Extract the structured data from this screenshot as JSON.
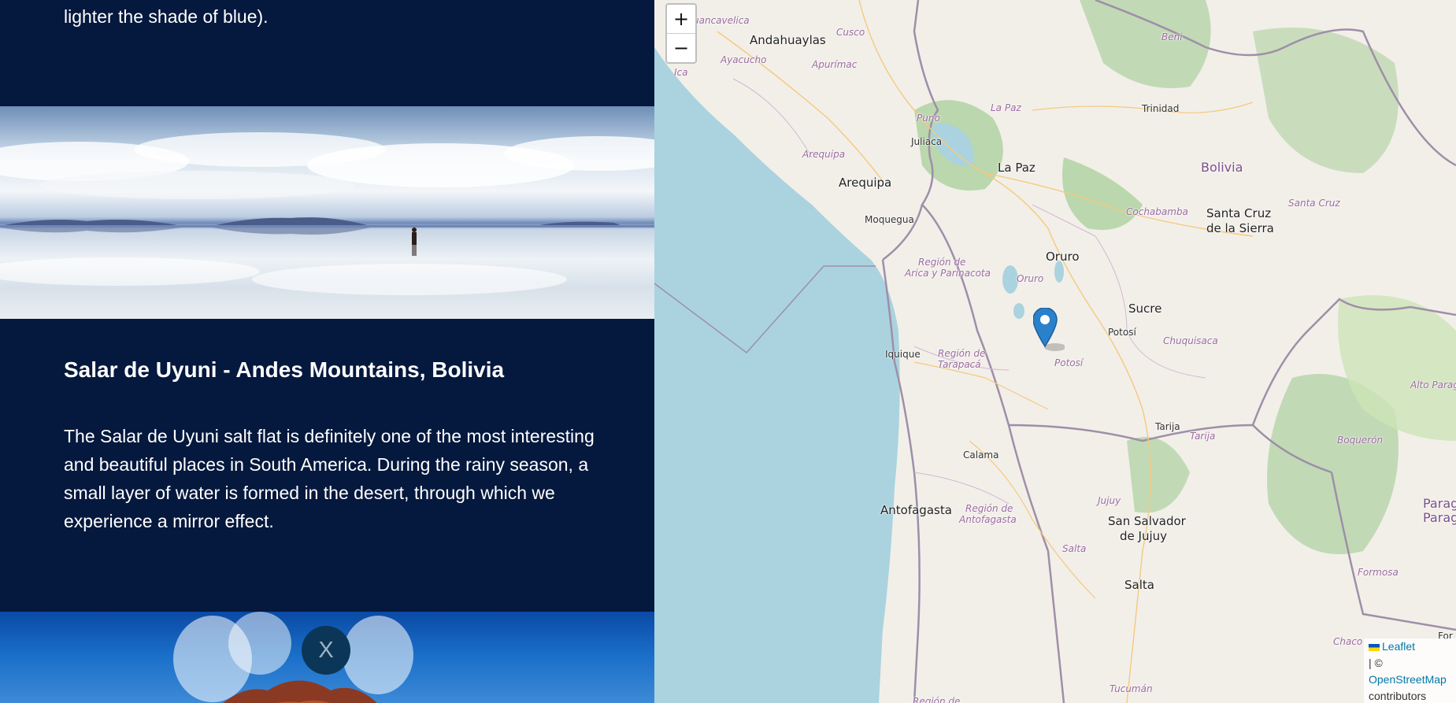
{
  "story": {
    "prev_text": "lighter the shade of blue).",
    "title": "Salar de Uyuni - Andes Mountains, Bolivia",
    "body": "The Salar de Uyuni salt flat is definitely one of the most interesting and beautiful places in South America. During the rainy season, a small layer of water is formed in the desert, through which we experience a mirror effect.",
    "close_label": "X"
  },
  "map": {
    "zoom_in": "+",
    "zoom_out": "−",
    "marker_icon": "map-pin-icon",
    "labels": {
      "andahuaylas": "Andahuaylas",
      "cusco": "Cusco",
      "huancavelica": "Huancavelica",
      "ayacucho": "Ayacucho",
      "apurimac": "Apurímac",
      "ica": "Ica",
      "beni": "Beni",
      "trinidad": "Trinidad",
      "puno": "Puno",
      "juliaca": "Juliaca",
      "la_paz_region": "La Paz",
      "la_paz": "La Paz",
      "bolivia": "Bolivia",
      "arequipa_region": "Arequipa",
      "arequipa": "Arequipa",
      "moquegua": "Moquegua",
      "cochabamba": "Cochabamba",
      "santa_cruz_city_1": "Santa Cruz",
      "santa_cruz_city_2": "de la Sierra",
      "santa_cruz_region": "Santa Cruz",
      "oruro": "Oruro",
      "oruro_region": "Oruro",
      "arica_1": "Región de",
      "arica_2": "Arica y Parinacota",
      "sucre": "Sucre",
      "potosi_city": "Potosí",
      "chuquisaca": "Chuquisaca",
      "iquique": "Iquique",
      "tarapaca_1": "Región de",
      "tarapaca_2": "Tarapacá",
      "potosi_region": "Potosí",
      "alto_paraguay": "Alto Paraguay",
      "boqueron": "Boquerón",
      "tarija": "Tarija",
      "tarija_region": "Tarija",
      "calama": "Calama",
      "antofagasta": "Antofagasta",
      "antofagasta_reg_1": "Región de",
      "antofagasta_reg_2": "Antofagasta",
      "jujuy": "Jujuy",
      "san_salvador_1": "San Salvador",
      "san_salvador_2": "de Jujuy",
      "paraguay_1": "Paragu",
      "paraguay_2": "Parag",
      "salta_region": "Salta",
      "salta": "Salta",
      "formosa": "Formosa",
      "chaco": "Chaco",
      "for": "For",
      "tucuman": "Tucumán",
      "region_de": "Región de"
    },
    "attribution": {
      "leaflet": "Leaflet",
      "sep": "| ©",
      "osm": "OpenStreetMap",
      "contributors": "contributors"
    },
    "colors": {
      "water": "#aad3df",
      "land": "#f2efe9",
      "forest": "#add19e",
      "border": "#9e8fa8",
      "marker": "#2a81cb"
    }
  }
}
